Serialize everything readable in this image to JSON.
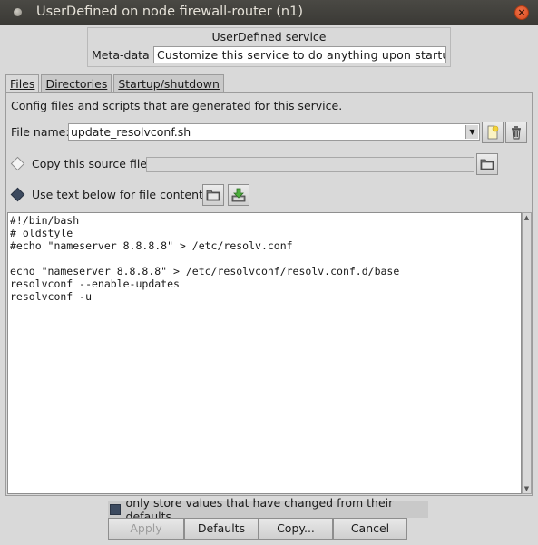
{
  "window": {
    "title": "UserDefined on node firewall-router (n1)",
    "close_label": "×"
  },
  "meta": {
    "service_title": "UserDefined service",
    "label": "Meta-data",
    "value": "Customize this service to do anything upon startup."
  },
  "tabs": [
    {
      "label": "Files",
      "active": true
    },
    {
      "label": "Directories",
      "active": false
    },
    {
      "label": "Startup/shutdown",
      "active": false
    }
  ],
  "files": {
    "description": "Config files and scripts that are generated for this service.",
    "file_name_label": "File name:",
    "file_name_value": "update_resolvconf.sh",
    "copy_source_label": "Copy this source file:",
    "copy_source_value": "",
    "use_text_label": "Use text below for file contents:",
    "contents": "#!/bin/bash\n# oldstyle\n#echo \"nameserver 8.8.8.8\" > /etc/resolv.conf\n\necho \"nameserver 8.8.8.8\" > /etc/resolvconf/resolv.conf.d/base\nresolvconf --enable-updates\nresolvconf -u"
  },
  "bottom": {
    "only_store_label": "only store values that have changed from their defaults",
    "only_store_checked": true,
    "buttons": {
      "apply": "Apply",
      "defaults": "Defaults",
      "copy": "Copy...",
      "cancel": "Cancel"
    }
  },
  "colors": {
    "titlebar": "#3c3b37",
    "close": "#e25a2b",
    "window_bg": "#d9d9d9",
    "selected_indicator": "#3c4a5f"
  },
  "icons": {
    "new_file": "new-file-icon",
    "delete": "trash-icon",
    "browse": "open-folder-icon",
    "load": "open-folder-icon",
    "save": "save-download-icon"
  }
}
